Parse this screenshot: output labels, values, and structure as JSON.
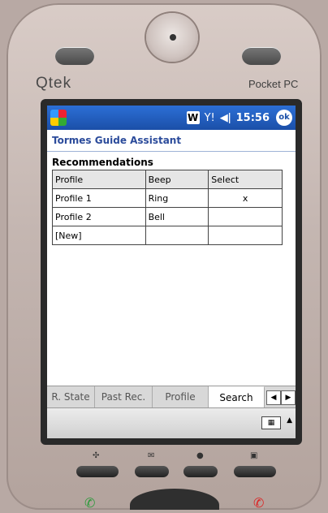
{
  "device": {
    "brand": "Qtek",
    "model_label": "Pocket PC"
  },
  "taskbar": {
    "time": "15:56",
    "ok_label": "ok",
    "w_label": "W"
  },
  "app": {
    "title": "Tormes Guide Assistant"
  },
  "recommendations": {
    "heading": "Recommendations",
    "columns": [
      "Profile",
      "Beep",
      "Select"
    ],
    "rows": [
      {
        "profile": "Profile 1",
        "beep": "Ring",
        "select": "x"
      },
      {
        "profile": "Profile 2",
        "beep": "Bell",
        "select": ""
      },
      {
        "profile": "[New]",
        "beep": "",
        "select": ""
      }
    ]
  },
  "tabs": [
    {
      "label": "R. State",
      "active": false
    },
    {
      "label": "Past Rec.",
      "active": false
    },
    {
      "label": "Profile",
      "active": false
    },
    {
      "label": "Search",
      "active": true
    }
  ],
  "colors": {
    "taskbar": "#1b4fa8",
    "title_text": "#2b4b9b"
  }
}
